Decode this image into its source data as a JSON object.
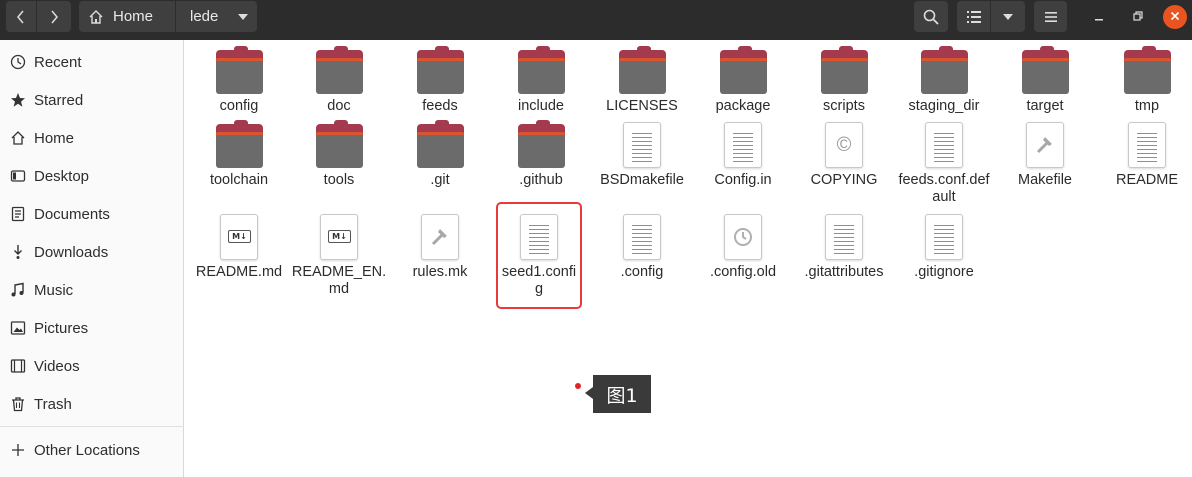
{
  "header": {
    "path": [
      {
        "label": "Home",
        "icon": "home-icon"
      },
      {
        "label": "lede",
        "icon": "chevron-down-icon"
      }
    ]
  },
  "sidebar": {
    "items": [
      {
        "label": "Recent",
        "icon": "recent-icon"
      },
      {
        "label": "Starred",
        "icon": "star-icon"
      },
      {
        "label": "Home",
        "icon": "home-icon"
      },
      {
        "label": "Desktop",
        "icon": "desktop-icon"
      },
      {
        "label": "Documents",
        "icon": "documents-icon"
      },
      {
        "label": "Downloads",
        "icon": "downloads-icon"
      },
      {
        "label": "Music",
        "icon": "music-icon"
      },
      {
        "label": "Pictures",
        "icon": "pictures-icon"
      },
      {
        "label": "Videos",
        "icon": "videos-icon"
      },
      {
        "label": "Trash",
        "icon": "trash-icon"
      },
      {
        "label": "Other Locations",
        "icon": "plus-icon"
      }
    ]
  },
  "files": [
    {
      "name": "config",
      "type": "folder"
    },
    {
      "name": "doc",
      "type": "folder"
    },
    {
      "name": "feeds",
      "type": "folder"
    },
    {
      "name": "include",
      "type": "folder"
    },
    {
      "name": "LICENSES",
      "type": "folder"
    },
    {
      "name": "package",
      "type": "folder"
    },
    {
      "name": "scripts",
      "type": "folder"
    },
    {
      "name": "staging_dir",
      "type": "folder"
    },
    {
      "name": "target",
      "type": "folder"
    },
    {
      "name": "tmp",
      "type": "folder"
    },
    {
      "name": "toolchain",
      "type": "folder"
    },
    {
      "name": "tools",
      "type": "folder"
    },
    {
      "name": ".git",
      "type": "folder"
    },
    {
      "name": ".github",
      "type": "folder"
    },
    {
      "name": "BSDmakefile",
      "type": "text"
    },
    {
      "name": "Config.in",
      "type": "text"
    },
    {
      "name": "COPYING",
      "type": "copyright"
    },
    {
      "name": "feeds.conf.default",
      "type": "text"
    },
    {
      "name": "Makefile",
      "type": "build"
    },
    {
      "name": "README",
      "type": "text"
    },
    {
      "name": "README.md",
      "type": "markdown"
    },
    {
      "name": "README_EN.md",
      "type": "markdown"
    },
    {
      "name": "rules.mk",
      "type": "build"
    },
    {
      "name": "seed1.config",
      "type": "text",
      "highlighted": true
    },
    {
      "name": ".config",
      "type": "text"
    },
    {
      "name": ".config.old",
      "type": "backup"
    },
    {
      "name": ".gitattributes",
      "type": "text"
    },
    {
      "name": ".gitignore",
      "type": "text"
    }
  ],
  "annotation": {
    "label": "图1",
    "color": "#e3232a"
  },
  "colors": {
    "header_bg": "#2c2c2c",
    "folder_tab": "#a33a4e",
    "folder_body": "#6b6b6b",
    "folder_accent": "#d9542f",
    "close_button": "#e95420",
    "highlight": "#e83a3a"
  }
}
